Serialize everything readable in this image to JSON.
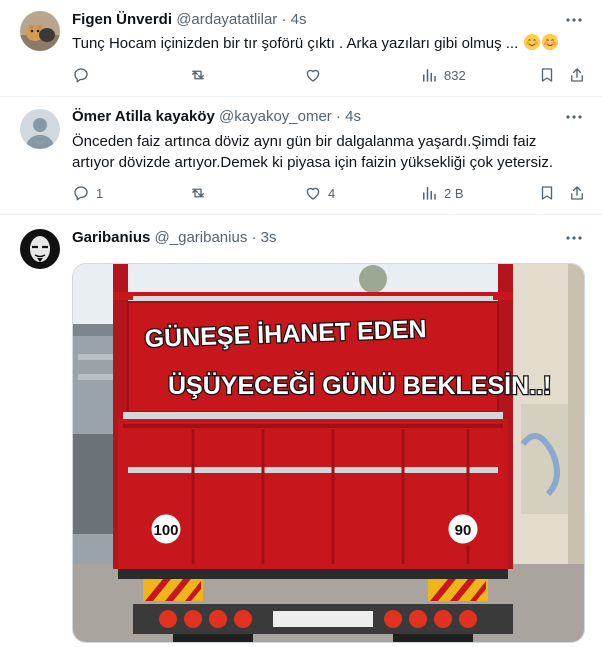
{
  "tweets": [
    {
      "name": "Figen Ünverdi",
      "handle": "@ardayatatlilar",
      "dot": "·",
      "time": "4s",
      "text": "Tunç Hocam içinizden bir tır şoförü çıktı . Arka yazıları gibi olmuş ...",
      "actions": {
        "reply": "",
        "retweet": "",
        "like": "",
        "views": "832"
      }
    },
    {
      "name": "Ömer Atilla kayaköy",
      "handle": "@kayakoy_omer",
      "dot": "·",
      "time": "4s",
      "text": "Önceden faiz artınca döviz aynı gün bir dalgalanma yaşardı.Şimdi faiz artıyor dövizde artıyor.Demek ki piyasa için faizin yüksekliği çok yetersiz.",
      "actions": {
        "reply": "1",
        "retweet": "",
        "like": "4",
        "views": "2 B"
      }
    },
    {
      "name": "Garibanius",
      "handle": "@_garibanius",
      "dot": "·",
      "time": "3s",
      "media": {
        "line1": "GÜNEŞE İHANET EDEN",
        "line2": "ÜŞÜYECEĞİ GÜNÜ BEKLESİN..!",
        "speed_left": "100",
        "speed_right": "90"
      }
    }
  ],
  "colors": {
    "text": "#0f1419",
    "muted": "#536471",
    "border": "#eff3f4",
    "truck_red": "#c8161d"
  }
}
